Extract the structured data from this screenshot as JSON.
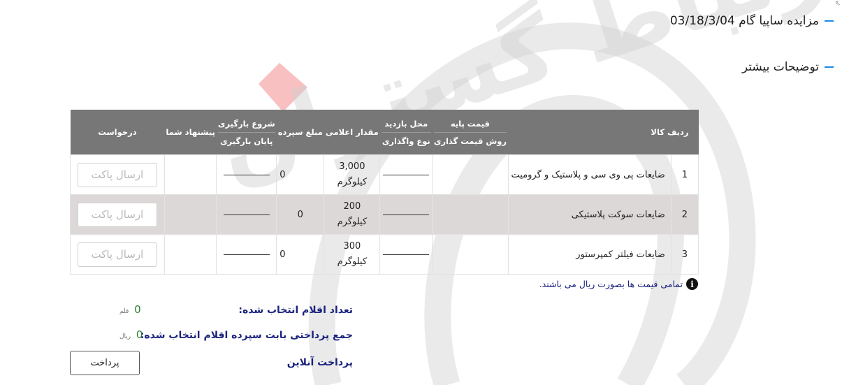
{
  "header": {
    "auction_title": "مزایده ساپیا گام 03/18/3/04",
    "more_details": "توضیحات بیشتر"
  },
  "table": {
    "columns": {
      "row_goods": "ردیف کالا",
      "base_price": "قیمت پایه",
      "pricing_method": "روش قیمت گذاری",
      "visit_place": "محل بازدید",
      "assignment_type": "نوع واگذاری",
      "declared_amount": "مقدار اعلامی",
      "deposit_amount": "مبلغ سپرده",
      "loading_start": "شروع بارگیری",
      "loading_end": "پایان بارگیری",
      "your_offer": "پیشنهاد شما",
      "request": "درخواست"
    },
    "rows": [
      {
        "index": "1",
        "name": "ضایعات پی وی سی و پلاستیک و گرومیت",
        "qty": "3,000",
        "unit": "کیلوگرم",
        "deposit": "0",
        "button": "ارسال پاکت"
      },
      {
        "index": "2",
        "name": "ضایعات سوکت پلاستیکی",
        "qty": "200",
        "unit": "کیلوگرم",
        "deposit": "0",
        "button": "ارسال پاکت"
      },
      {
        "index": "3",
        "name": "ضایعات فیلتر کمپرستور",
        "qty": "300",
        "unit": "کیلوگرم",
        "deposit": "0",
        "button": "ارسال پاکت"
      }
    ]
  },
  "note": "تمامی قیمت ها بصورت ریال می باشند.",
  "summary": {
    "selected_count_label": "تعداد اقلام انتخاب شده:",
    "selected_count_value": "0",
    "selected_count_unit": "قلم",
    "total_payment_label": "جمع پرداختی بابت سپرده اقلام انتخاب شده:",
    "total_payment_value": "0",
    "total_payment_unit": "ریال",
    "online_payment_label": "پرداخت آنلاین",
    "pay_button": "پرداخت"
  },
  "watermark_text": "همراه ارتباط گستران",
  "colors": {
    "accent": "#1e88e5",
    "header_bg": "#777777",
    "alt_row": "#ddd8d8",
    "note_text": "#1a237e",
    "value_green": "#2e7d32"
  }
}
